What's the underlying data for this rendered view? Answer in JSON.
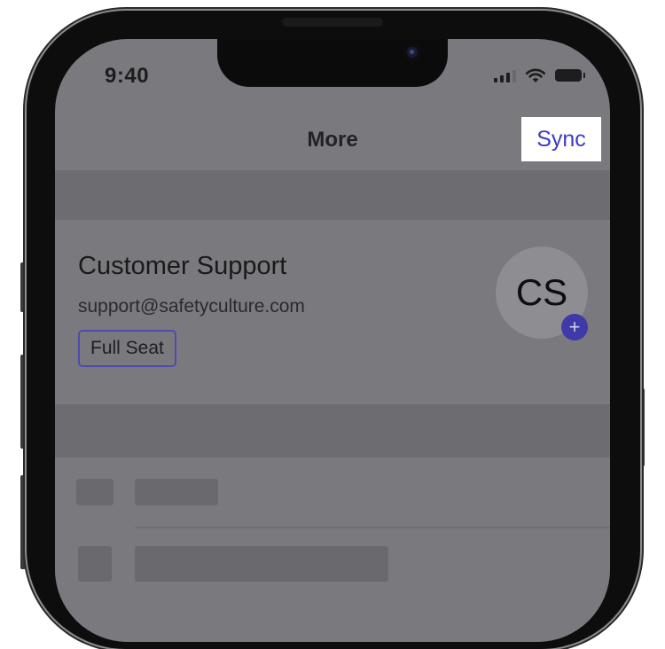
{
  "status_bar": {
    "time": "9:40",
    "icons": [
      "signal-icon",
      "wifi-icon",
      "battery-icon"
    ]
  },
  "nav": {
    "title": "More",
    "sync_label": "Sync"
  },
  "profile": {
    "name": "Customer Support",
    "email": "support@safetyculture.com",
    "seat": "Full Seat",
    "initials": "CS",
    "add_icon": "plus-icon"
  },
  "colors": {
    "accent": "#3f3ac4",
    "overlay": "#7a7a7e"
  }
}
